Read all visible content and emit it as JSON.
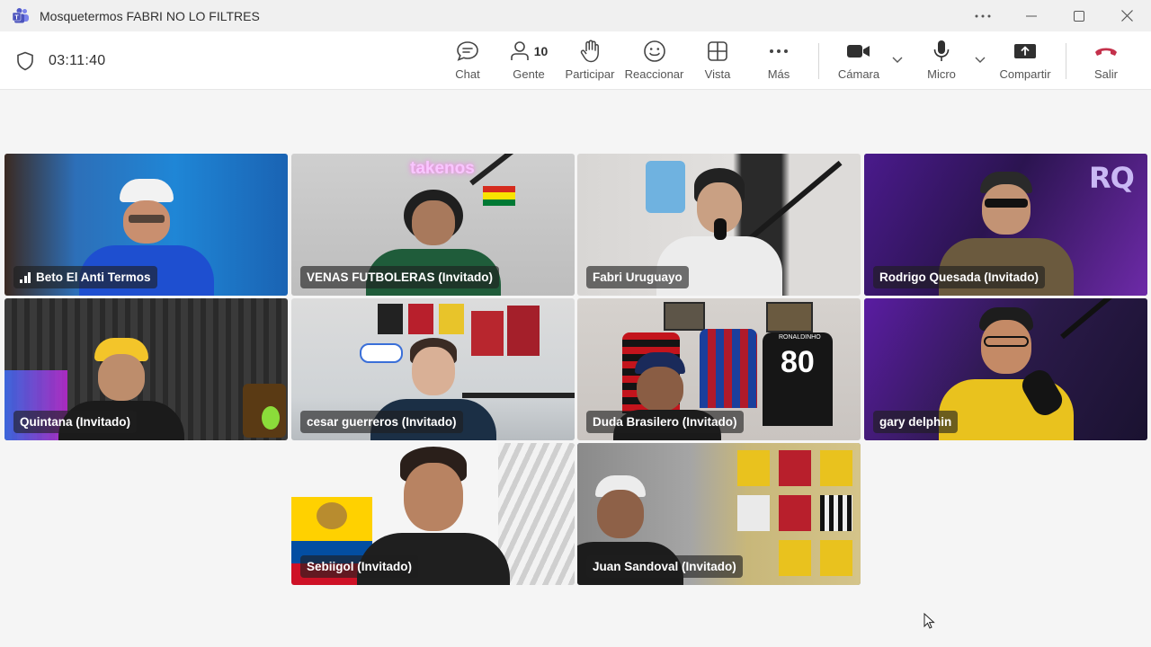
{
  "window": {
    "title": "Mosquetermos FABRI NO LO FILTRES"
  },
  "call": {
    "timer": "03:11:40",
    "participant_count": "10"
  },
  "toolbar": {
    "chat": "Chat",
    "people": "Gente",
    "raise_hand": "Participar",
    "react": "Reaccionar",
    "view": "Vista",
    "more": "Más",
    "camera": "Cámara",
    "mic": "Micro",
    "share": "Compartir",
    "leave": "Salir"
  },
  "participants": [
    {
      "name": "Beto El Anti Termos"
    },
    {
      "name": "VENAS FUTBOLERAS (Invitado)"
    },
    {
      "name": "Fabri Uruguayo"
    },
    {
      "name": "Rodrigo Quesada (Invitado)"
    },
    {
      "name": "Quintana (Invitado)"
    },
    {
      "name": "cesar guerreros (Invitado)"
    },
    {
      "name": "Duda Brasilero (Invitado)"
    },
    {
      "name": "gary delphin"
    },
    {
      "name": "Sebiigol (Invitado)"
    },
    {
      "name": "Juan Sandoval (Invitado)"
    }
  ],
  "background_text": {
    "neon_sign": "takenos",
    "jersey_number": "80",
    "jersey_name": "RONALDINHO"
  },
  "colors": {
    "accent": "#6264a7",
    "leave": "#c4314b"
  }
}
